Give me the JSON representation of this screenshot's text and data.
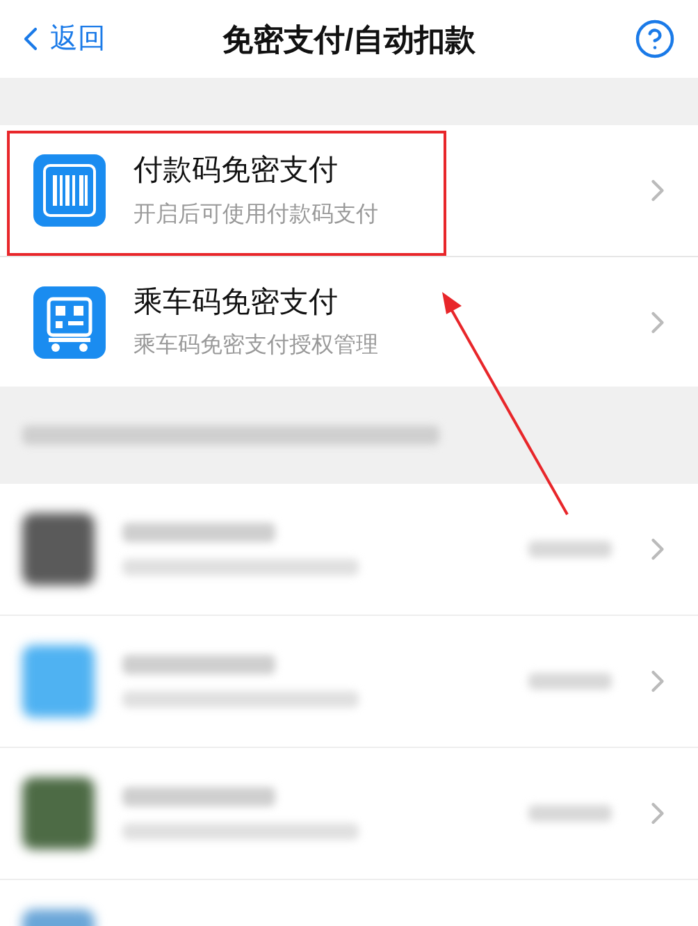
{
  "header": {
    "back_label": "返回",
    "title": "免密支付/自动扣款"
  },
  "options": [
    {
      "kind": "barcode",
      "title": "付款码免密支付",
      "subtitle": "开启后可使用付款码支付",
      "highlighted": true
    },
    {
      "kind": "transit",
      "title": "乘车码免密支付",
      "subtitle": "乘车码免密支付授权管理",
      "highlighted": false
    }
  ],
  "blurred_rows": [
    {
      "color": "#5a5a5a",
      "partial": false
    },
    {
      "color": "#4fb2f2",
      "partial": false
    },
    {
      "color": "#4d6b45",
      "partial": false
    },
    {
      "color": "#6aa6d8",
      "partial": true
    }
  ]
}
